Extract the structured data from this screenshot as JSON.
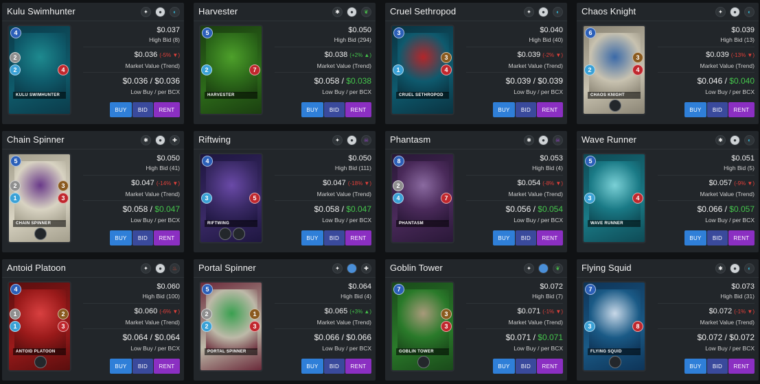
{
  "buttons": {
    "buy": "BUY",
    "bid": "BID",
    "rent": "RENT"
  },
  "labels": {
    "market_value": "Market Value (Trend)",
    "low_buy": "Low Buy / per BCX"
  },
  "colors": {
    "trend_down": "#e0403a",
    "trend_up": "#43c04a",
    "buy": "#2f7fd8",
    "bid": "#3a4a9c",
    "rent": "#8b2fc2"
  },
  "cards": [
    {
      "name": "Kulu Swimhunter",
      "card_label": "Kulu Swimhunter",
      "icons": [
        "rarity-common-icon",
        "foil-icon",
        "water-element-icon"
      ],
      "mana": "4",
      "armor": "2",
      "speed": "2",
      "attack": "",
      "health": "4",
      "abilities": 0,
      "high_bid_price": "$0.037",
      "high_bid_label": "High Bid (8)",
      "market_price": "$0.036",
      "trend": "(-5%",
      "trend_dir": "down",
      "low_buy_a": "$0.036 / ",
      "low_buy_b": "$0.036",
      "low_green": false,
      "theme": [
        "#0f5b6b",
        "#1e8a8f",
        "#0b3b4a"
      ]
    },
    {
      "name": "Harvester",
      "card_label": "Harvester",
      "icons": [
        "rarity-rare-icon",
        "foil-icon",
        "earth-element-icon"
      ],
      "mana": "5",
      "armor": "",
      "speed": "2",
      "attack": "",
      "health": "7",
      "abilities": 0,
      "high_bid_price": "$0.050",
      "high_bid_label": "High Bid (294)",
      "market_price": "$0.038",
      "trend": "(+2%",
      "trend_dir": "up",
      "low_buy_a": "$0.058 / ",
      "low_buy_b": "$0.038",
      "low_green": true,
      "theme": [
        "#2d6b1a",
        "#4ea02b",
        "#1b3f10"
      ]
    },
    {
      "name": "Cruel Sethropod",
      "card_label": "Cruel Sethropod",
      "icons": [
        "rarity-common-icon",
        "foil-icon",
        "water-element-icon"
      ],
      "mana": "3",
      "armor": "",
      "speed": "1",
      "attack": "3",
      "health": "4",
      "abilities": 0,
      "high_bid_price": "$0.040",
      "high_bid_label": "High Bid (40)",
      "market_price": "$0.039",
      "trend": "(-2%",
      "trend_dir": "down",
      "low_buy_a": "$0.039 / ",
      "low_buy_b": "$0.039",
      "low_green": false,
      "theme": [
        "#0e5a6e",
        "#b3262a",
        "#0a3341"
      ]
    },
    {
      "name": "Chaos Knight",
      "card_label": "Chaos Knight",
      "icons": [
        "rarity-common-icon",
        "foil-icon",
        "water-element-icon"
      ],
      "mana": "6",
      "armor": "",
      "speed": "2",
      "attack": "3",
      "health": "4",
      "abilities": 1,
      "high_bid_price": "$0.039",
      "high_bid_label": "High Bid (13)",
      "market_price": "$0.039",
      "trend": "(-13%",
      "trend_dir": "down",
      "low_buy_a": "$0.046 / ",
      "low_buy_b": "$0.040",
      "low_green": true,
      "theme": [
        "#c8c2b0",
        "#3b6aa8",
        "#8a8474"
      ]
    },
    {
      "name": "Chain Spinner",
      "card_label": "Chain Spinner",
      "icons": [
        "rarity-rare-icon",
        "foil-icon",
        "neutral-element-icon"
      ],
      "mana": "5",
      "armor": "2",
      "speed": "1",
      "attack": "3",
      "health": "3",
      "abilities": 1,
      "high_bid_price": "$0.050",
      "high_bid_label": "High Bid (41)",
      "market_price": "$0.047",
      "trend": "(-14%",
      "trend_dir": "down",
      "low_buy_a": "$0.058 / ",
      "low_buy_b": "$0.047",
      "low_green": true,
      "theme": [
        "#d8d3c2",
        "#6a3a8a",
        "#a39e8c"
      ]
    },
    {
      "name": "Riftwing",
      "card_label": "Riftwing",
      "icons": [
        "rarity-common-icon",
        "foil-icon",
        "death-element-icon"
      ],
      "mana": "4",
      "armor": "",
      "speed": "3",
      "attack": "",
      "health": "5",
      "abilities": 2,
      "high_bid_price": "$0.050",
      "high_bid_label": "High Bid (111)",
      "market_price": "$0.047",
      "trend": "(-18%",
      "trend_dir": "down",
      "low_buy_a": "$0.058 / ",
      "low_buy_b": "$0.047",
      "low_green": true,
      "theme": [
        "#3a2a66",
        "#6a4aa8",
        "#1e1640"
      ]
    },
    {
      "name": "Phantasm",
      "card_label": "Phantasm",
      "icons": [
        "rarity-rare-icon",
        "foil-icon",
        "death-element-icon"
      ],
      "mana": "8",
      "armor": "2",
      "speed": "4",
      "attack": "",
      "health": "7",
      "abilities": 0,
      "high_bid_price": "$0.053",
      "high_bid_label": "High Bid (4)",
      "market_price": "$0.054",
      "trend": "(-8%",
      "trend_dir": "down",
      "low_buy_a": "$0.056 / ",
      "low_buy_b": "$0.054",
      "low_green": true,
      "theme": [
        "#4a2a5a",
        "#8a6aa0",
        "#2a1838"
      ]
    },
    {
      "name": "Wave Runner",
      "card_label": "Wave Runner",
      "icons": [
        "rarity-rare-icon",
        "foil-icon",
        "water-element-icon"
      ],
      "mana": "5",
      "armor": "",
      "speed": "3",
      "attack": "",
      "health": "4",
      "abilities": 0,
      "high_bid_price": "$0.051",
      "high_bid_label": "High Bid (5)",
      "market_price": "$0.057",
      "trend": "(-9%",
      "trend_dir": "down",
      "low_buy_a": "$0.066 / ",
      "low_buy_b": "$0.057",
      "low_green": true,
      "theme": [
        "#1a7a86",
        "#7ad0d6",
        "#0e4a55"
      ]
    },
    {
      "name": "Antoid Platoon",
      "card_label": "Antoid Platoon",
      "icons": [
        "rarity-common-icon",
        "foil-icon",
        "fire-element-icon"
      ],
      "mana": "4",
      "armor": "1",
      "speed": "1",
      "attack": "2",
      "health": "3",
      "abilities": 1,
      "high_bid_price": "$0.060",
      "high_bid_label": "High Bid (100)",
      "market_price": "$0.060",
      "trend": "(-6%",
      "trend_dir": "down",
      "low_buy_a": "$0.064 / ",
      "low_buy_b": "$0.064",
      "low_green": false,
      "theme": [
        "#9a1a1a",
        "#d84040",
        "#5a0e0e"
      ]
    },
    {
      "name": "Portal Spinner",
      "card_label": "Portal Spinner",
      "icons": [
        "rarity-common-icon",
        "foil-gold-icon",
        "neutral-element-icon"
      ],
      "mana": "5",
      "armor": "2",
      "speed": "2",
      "attack": "1",
      "health": "3",
      "abilities": 0,
      "high_bid_price": "$0.064",
      "high_bid_label": "High Bid (4)",
      "market_price": "$0.065",
      "trend": "(+3%",
      "trend_dir": "up",
      "low_buy_a": "$0.066 / ",
      "low_buy_b": "$0.066",
      "low_green": false,
      "theme": [
        "#bdb9a8",
        "#3aa050",
        "#6a2a3a"
      ]
    },
    {
      "name": "Goblin Tower",
      "card_label": "Goblin Tower",
      "icons": [
        "rarity-common-icon",
        "foil-gold-icon",
        "earth-element-icon"
      ],
      "mana": "7",
      "armor": "",
      "speed": "",
      "attack": "3",
      "health": "3",
      "abilities": 1,
      "high_bid_price": "$0.072",
      "high_bid_label": "High Bid (7)",
      "market_price": "$0.071",
      "trend": "(-1%",
      "trend_dir": "down",
      "low_buy_a": "$0.071 / ",
      "low_buy_b": "$0.071",
      "low_green": true,
      "theme": [
        "#2a7a2a",
        "#a89a7a",
        "#1a4a1a"
      ]
    },
    {
      "name": "Flying Squid",
      "card_label": "Flying Squid",
      "icons": [
        "rarity-rare-icon",
        "foil-icon",
        "water-element-icon"
      ],
      "mana": "7",
      "armor": "",
      "speed": "3",
      "attack": "",
      "health": "8",
      "abilities": 1,
      "high_bid_price": "$0.073",
      "high_bid_label": "High Bid (31)",
      "market_price": "$0.072",
      "trend": "(-1%",
      "trend_dir": "down",
      "low_buy_a": "$0.072 / ",
      "low_buy_b": "$0.072",
      "low_green": false,
      "theme": [
        "#1a5a86",
        "#c8d8e8",
        "#0e3458"
      ]
    }
  ]
}
